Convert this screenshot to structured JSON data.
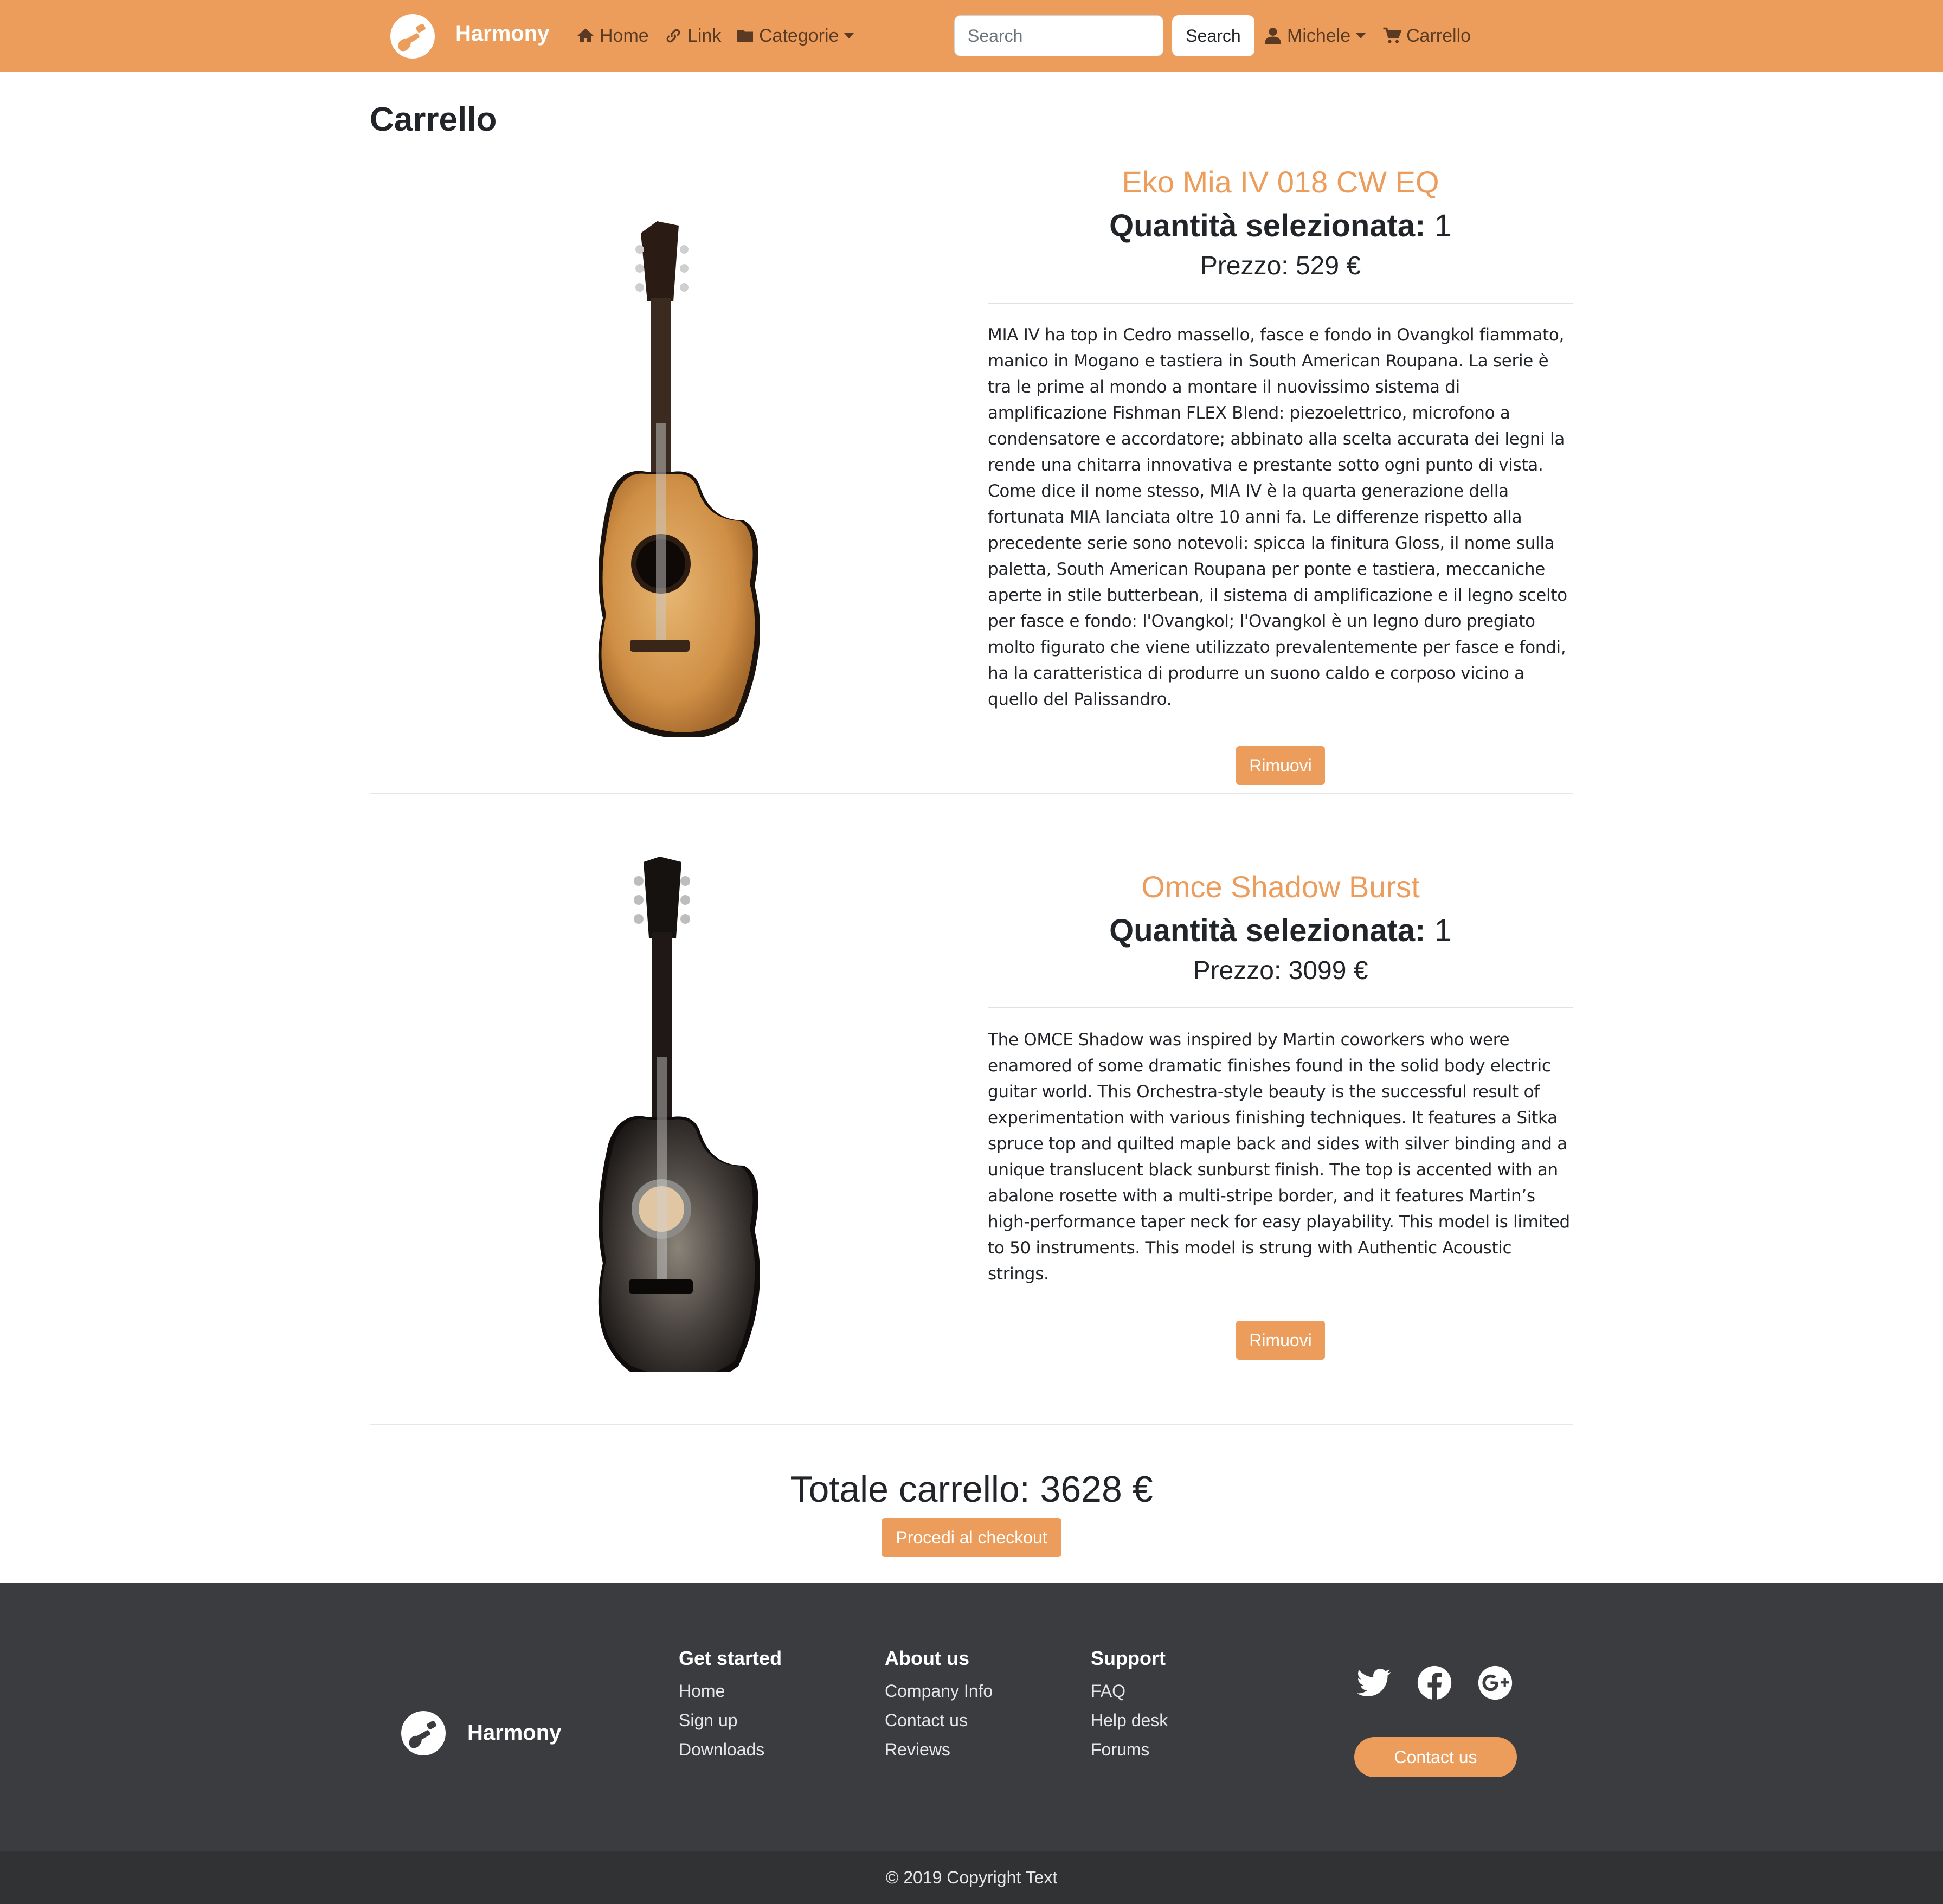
{
  "navbar": {
    "brand": "Harmony",
    "home": "Home",
    "link": "Link",
    "categories": "Categorie",
    "search_placeholder": "Search",
    "search_button": "Search",
    "user": "Michele",
    "cart": "Carrello"
  },
  "page_title": "Carrello",
  "products": [
    {
      "name": "Eko Mia IV 018 CW EQ",
      "qty_label": "Quantità selezionata:",
      "qty": "1",
      "price": "Prezzo: 529 €",
      "description": "MIA IV ha top in Cedro massello, fasce e fondo in Ovangkol fiammato, manico in Mogano e tastiera in South American Roupana. La serie è tra le prime al mondo a montare il nuovissimo sistema di amplificazione Fishman FLEX Blend: piezoelettrico, microfono a condensatore e accordatore; abbinato alla scelta accurata dei legni la rende una chitarra innovativa e prestante sotto ogni punto di vista. Come dice il nome stesso, MIA IV è la quarta generazione della fortunata MIA lanciata oltre 10 anni fa. Le differenze rispetto alla precedente serie sono notevoli: spicca la finitura Gloss, il nome sulla paletta, South American Roupana per ponte e tastiera, meccaniche aperte in stile butterbean, il sistema di amplificazione e il legno scelto per fasce e fondo: l'Ovangkol; l'Ovangkol è un legno duro pregiato molto figurato che viene utilizzato prevalentemente per fasce e fondi, ha la caratteristica di produrre un suono caldo e corposo vicino a quello del Palissandro.",
      "remove": "Rimuovi"
    },
    {
      "name": "Omce Shadow Burst",
      "qty_label": "Quantità selezionata:",
      "qty": "1",
      "price": "Prezzo: 3099 €",
      "description": "The OMCE Shadow was inspired by Martin coworkers who were enamored of some dramatic finishes found in the solid body electric guitar world. This Orchestra-style beauty is the successful result of experimentation with various finishing techniques. It features a Sitka spruce top and quilted maple back and sides with silver binding and a unique translucent black sunburst finish. The top is accented with an abalone rosette with a multi-stripe border, and it features Martin’s high-performance taper neck for easy playability. This model is limited to 50 instruments. This model is strung with Authentic Acoustic strings.",
      "remove": "Rimuovi"
    }
  ],
  "total": "Totale carrello: 3628 €",
  "checkout": "Procedi al checkout",
  "footer": {
    "brand": "Harmony",
    "col1": {
      "title": "Get started",
      "links": [
        "Home",
        "Sign up",
        "Downloads"
      ]
    },
    "col2": {
      "title": "About us",
      "links": [
        "Company Info",
        "Contact us",
        "Reviews"
      ]
    },
    "col3": {
      "title": "Support",
      "links": [
        "FAQ",
        "Help desk",
        "Forums"
      ]
    },
    "contact": "Contact us",
    "copyright": "© 2019 Copyright Text"
  },
  "colors": {
    "accent": "#ec9d5b",
    "footer_bg": "#3b3c40",
    "copyright_bg": "#313234"
  },
  "icons": [
    "guitar-logo-icon",
    "home-icon",
    "link-icon",
    "folder-icon",
    "user-icon",
    "cart-icon",
    "twitter-icon",
    "facebook-icon",
    "google-plus-icon"
  ]
}
